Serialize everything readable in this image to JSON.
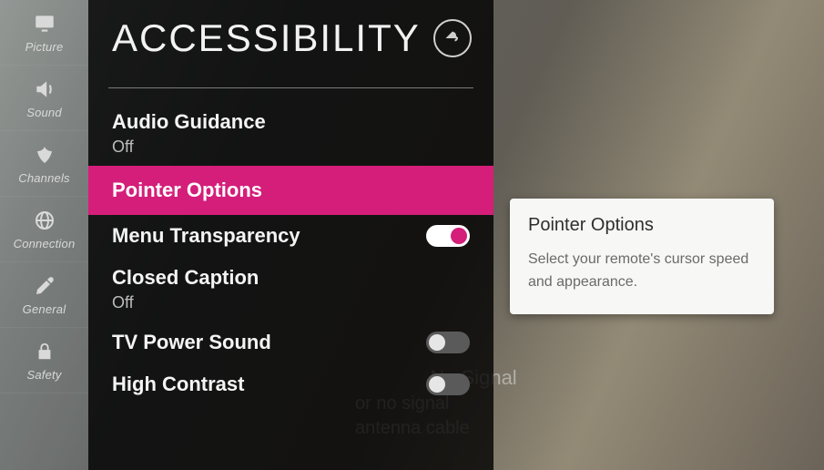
{
  "sidebar": {
    "items": [
      {
        "label": "Picture",
        "icon": "picture-icon"
      },
      {
        "label": "Sound",
        "icon": "sound-icon"
      },
      {
        "label": "Channels",
        "icon": "channels-icon"
      },
      {
        "label": "Connection",
        "icon": "connection-icon"
      },
      {
        "label": "General",
        "icon": "general-icon"
      },
      {
        "label": "Safety",
        "icon": "safety-icon"
      }
    ]
  },
  "panel": {
    "title": "ACCESSIBILITY",
    "options": [
      {
        "title": "Audio Guidance",
        "value": "Off",
        "type": "sub"
      },
      {
        "title": "Pointer Options",
        "type": "nav",
        "selected": true
      },
      {
        "title": "Menu Transparency",
        "type": "toggle",
        "state": "on"
      },
      {
        "title": "Closed Caption",
        "value": "Off",
        "type": "sub"
      },
      {
        "title": "TV Power Sound",
        "type": "toggle",
        "state": "off"
      },
      {
        "title": "High Contrast",
        "type": "toggle",
        "state": "off"
      }
    ]
  },
  "description": {
    "title": "Pointer Options",
    "body": "Select your remote's cursor speed and appearance."
  },
  "background": {
    "line1": "No Signal",
    "line2": "or no signal",
    "line3": "antenna cable"
  },
  "colors": {
    "accent": "#d41e7a"
  }
}
